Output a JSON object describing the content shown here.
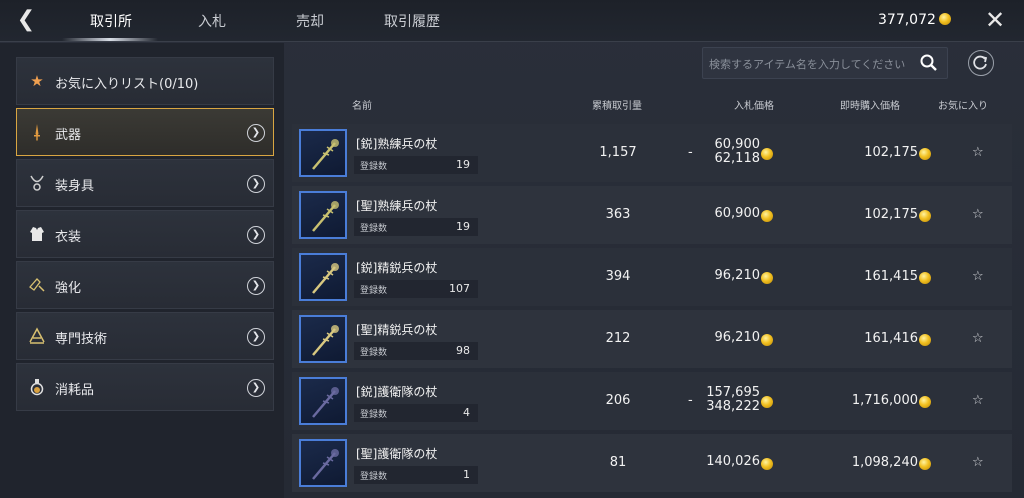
{
  "header": {
    "tabs": [
      {
        "label": "取引所"
      },
      {
        "label": "入札"
      },
      {
        "label": "売却"
      },
      {
        "label": "取引履歴"
      }
    ],
    "gold": "377,072"
  },
  "menu": [
    {
      "label": "お気に入りリスト(0/10)",
      "icon": "star-icon"
    },
    {
      "label": "武器",
      "icon": "sword-icon"
    },
    {
      "label": "装身具",
      "icon": "necklace-icon"
    },
    {
      "label": "衣装",
      "icon": "costume-icon"
    },
    {
      "label": "強化",
      "icon": "enhance-icon"
    },
    {
      "label": "専門技術",
      "icon": "crafting-icon"
    },
    {
      "label": "消耗品",
      "icon": "potion-icon"
    }
  ],
  "search": {
    "placeholder": "検索するアイテム名を入力してください"
  },
  "table": {
    "headers": {
      "name": "名前",
      "cumulative": "累積取引量",
      "bid": "入札価格",
      "buyout": "即時購入価格",
      "favorite": "お気に入り"
    },
    "reg_label": "登録数",
    "rows": [
      {
        "name": "[鋭]熟練兵の杖",
        "reg": "19",
        "cum": "1,157",
        "bid_low": "60,900",
        "bid_high": "62,118",
        "buy": "102,175"
      },
      {
        "name": "[聖]熟練兵の杖",
        "reg": "19",
        "cum": "363",
        "bid_low": "60,900",
        "bid_high": "",
        "buy": "102,175"
      },
      {
        "name": "[鋭]精鋭兵の杖",
        "reg": "107",
        "cum": "394",
        "bid_low": "96,210",
        "bid_high": "",
        "buy": "161,415"
      },
      {
        "name": "[聖]精鋭兵の杖",
        "reg": "98",
        "cum": "212",
        "bid_low": "96,210",
        "bid_high": "",
        "buy": "161,416"
      },
      {
        "name": "[鋭]護衛隊の杖",
        "reg": "4",
        "cum": "206",
        "bid_low": "157,695",
        "bid_high": "348,222",
        "buy": "1,716,000"
      },
      {
        "name": "[聖]護衛隊の杖",
        "reg": "1",
        "cum": "81",
        "bid_low": "140,026",
        "bid_high": "",
        "buy": "1,098,240"
      }
    ]
  }
}
